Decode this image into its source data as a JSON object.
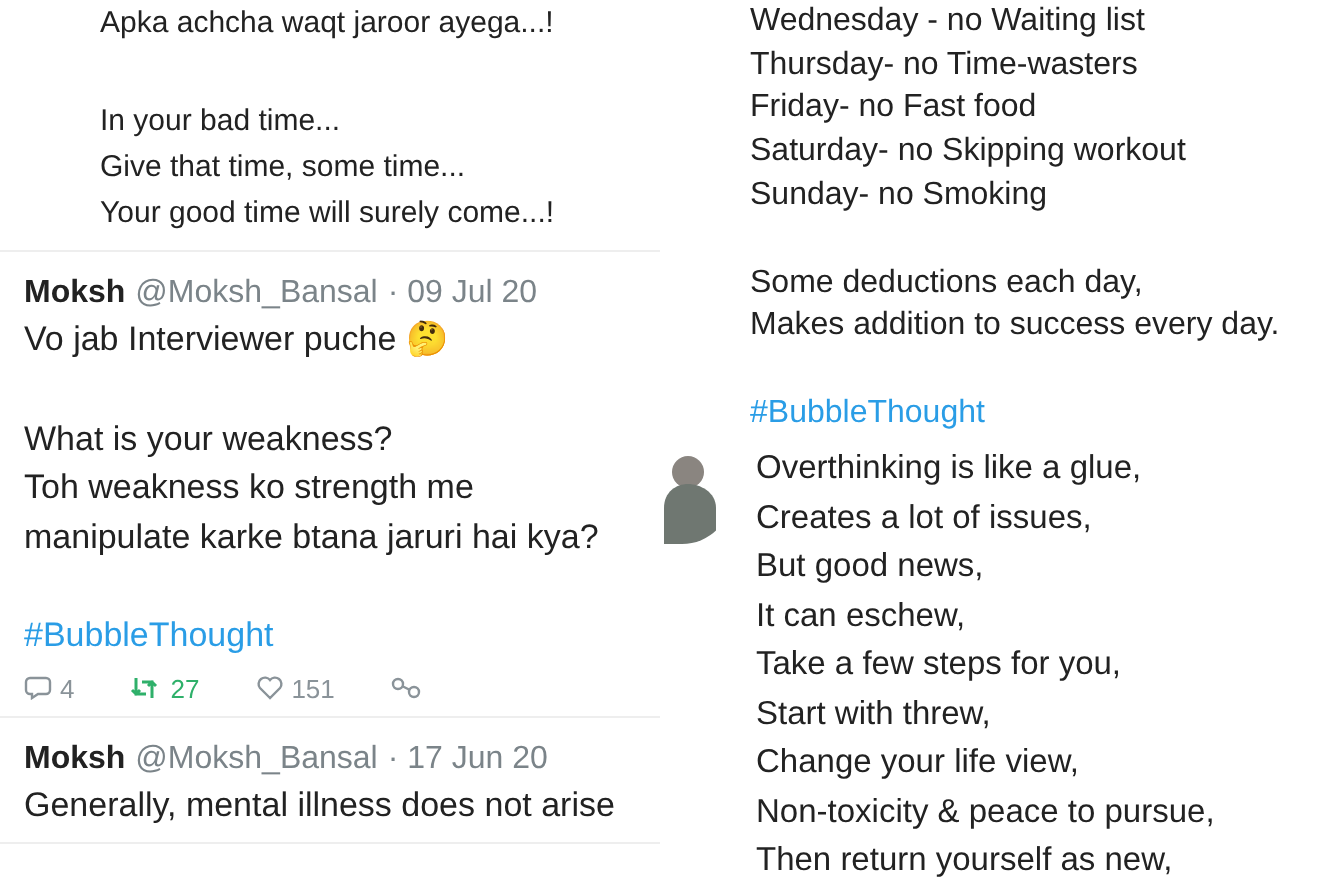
{
  "left_column": {
    "fragment": {
      "paragraphs": [
        [
          "Apka achcha waqt jaroor ayega...!"
        ],
        [
          "In your bad time...",
          "Give that time, some time...",
          "Your good time will surely come...!"
        ]
      ]
    },
    "tweets": [
      {
        "name": "Moksh",
        "handle": "@Moksh_Bansal",
        "date": "· 09 Jul 20",
        "paragraphs": [
          [
            "Vo jab Interviewer puche 🤔"
          ],
          [
            "What is your weakness?",
            "Toh weakness ko strength me",
            "manipulate karke btana jaruri hai kya?"
          ],
          [
            "#BubbleThought"
          ]
        ],
        "actions": [
          {
            "kind": "reply",
            "count": "4",
            "on": false
          },
          {
            "kind": "retweet",
            "count": "27",
            "on": true
          },
          {
            "kind": "like",
            "count": "151",
            "on": false
          },
          {
            "kind": "share",
            "on": false
          }
        ]
      },
      {
        "name": "Moksh",
        "handle": "@Moksh_Bansal",
        "date": "· 17 Jun 20",
        "paragraphs": [
          [
            "Generally, mental illness does not arise"
          ]
        ]
      }
    ]
  },
  "right_column": {
    "fragment": {
      "paragraphs": [
        [
          "Wednesday - no Waiting list",
          "Thursday- no Time-wasters",
          "Friday- no Fast food",
          "Saturday- no Skipping workout",
          "Sunday- no Smoking"
        ],
        [
          "Some deductions each day,",
          "Makes addition to success every day."
        ],
        [
          "#BubbleThought"
        ]
      ]
    },
    "tweet": {
      "paragraphs": [
        [
          "Overthinking is like a glue,",
          "Creates a lot of issues,",
          "But good news,",
          "It can eschew,",
          "Take a few steps for you,",
          "Start with threw,",
          "Change your life view,",
          "Non-toxicity & peace to pursue,",
          "Then return yourself as new,"
        ]
      ]
    }
  }
}
